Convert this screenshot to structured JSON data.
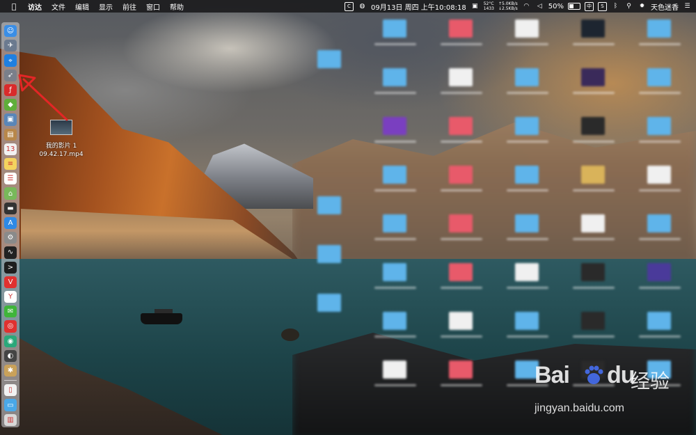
{
  "menubar": {
    "app_name": "访达",
    "items": [
      "文件",
      "编辑",
      "显示",
      "前往",
      "窗口",
      "帮助"
    ],
    "status": {
      "cpu_temp": "52°C",
      "cpu_rpm": "1433",
      "net_up": "↑5.0KB/s",
      "net_down": "↓2.5KB/s",
      "clock": "09月13日 周四 上午10:08:18",
      "battery": "50%",
      "input_method": "中",
      "user": "天色迷香"
    }
  },
  "desktop": {
    "file": {
      "name_line1": "我的影片 1",
      "name_line2": "09.42.17.mp4"
    }
  },
  "watermark": {
    "logo_text": "Bai",
    "logo_text2": "du",
    "cn_text": "经验",
    "url": "jingyan.baidu.com"
  },
  "dock": {
    "icons": [
      {
        "name": "finder-icon",
        "color": "#3a8ee6",
        "glyph": "☺"
      },
      {
        "name": "launchpad-icon",
        "color": "#6b7a8f",
        "glyph": "✈"
      },
      {
        "name": "safari-icon",
        "color": "#1f7fe0",
        "glyph": "⌖"
      },
      {
        "name": "rocket-icon",
        "color": "#7a7f8a",
        "glyph": "➶"
      },
      {
        "name": "flash-icon",
        "color": "#d92b2b",
        "glyph": "ƒ"
      },
      {
        "name": "android-icon",
        "color": "#5fae3a",
        "glyph": "◆"
      },
      {
        "name": "preview-icon",
        "color": "#5a86b8",
        "glyph": "▣"
      },
      {
        "name": "contacts-icon",
        "color": "#b8874a",
        "glyph": "▤"
      },
      {
        "name": "calendar-icon",
        "color": "#f2f2f2",
        "glyph": "13"
      },
      {
        "name": "notes-icon",
        "color": "#f4d35e",
        "glyph": "≡"
      },
      {
        "name": "reminders-icon",
        "color": "#ffffff",
        "glyph": "☰"
      },
      {
        "name": "maps-icon",
        "color": "#78b85a",
        "glyph": "⌂"
      },
      {
        "name": "photo-booth-icon",
        "color": "#333333",
        "glyph": "▬"
      },
      {
        "name": "app-store-icon",
        "color": "#2d89e6",
        "glyph": "A"
      },
      {
        "name": "system-preferences-icon",
        "color": "#8a8a8a",
        "glyph": "⚙"
      },
      {
        "name": "activity-monitor-icon",
        "color": "#222222",
        "glyph": "∿"
      },
      {
        "name": "terminal-icon",
        "color": "#1e1e1e",
        "glyph": ">"
      },
      {
        "name": "vivaldi-icon",
        "color": "#e0312f",
        "glyph": "V"
      },
      {
        "name": "yandex-icon",
        "color": "#ffffff",
        "glyph": "Y"
      },
      {
        "name": "wechat-icon",
        "color": "#3fb53a",
        "glyph": "✉"
      },
      {
        "name": "weibo-icon",
        "color": "#e0312f",
        "glyph": "◎"
      },
      {
        "name": "green-app-icon",
        "color": "#2aa87a",
        "glyph": "◉"
      },
      {
        "name": "qq-icon",
        "color": "#444444",
        "glyph": "◐"
      },
      {
        "name": "gear-app-icon",
        "color": "#c9a15a",
        "glyph": "✱"
      }
    ],
    "bottom_icons": [
      {
        "name": "document-icon",
        "color": "#f2f2f2",
        "glyph": "▯"
      },
      {
        "name": "folder-icon",
        "color": "#4aa8e8",
        "glyph": "▭"
      },
      {
        "name": "trash-icon",
        "color": "#d8d8d8",
        "glyph": "▥"
      }
    ]
  }
}
